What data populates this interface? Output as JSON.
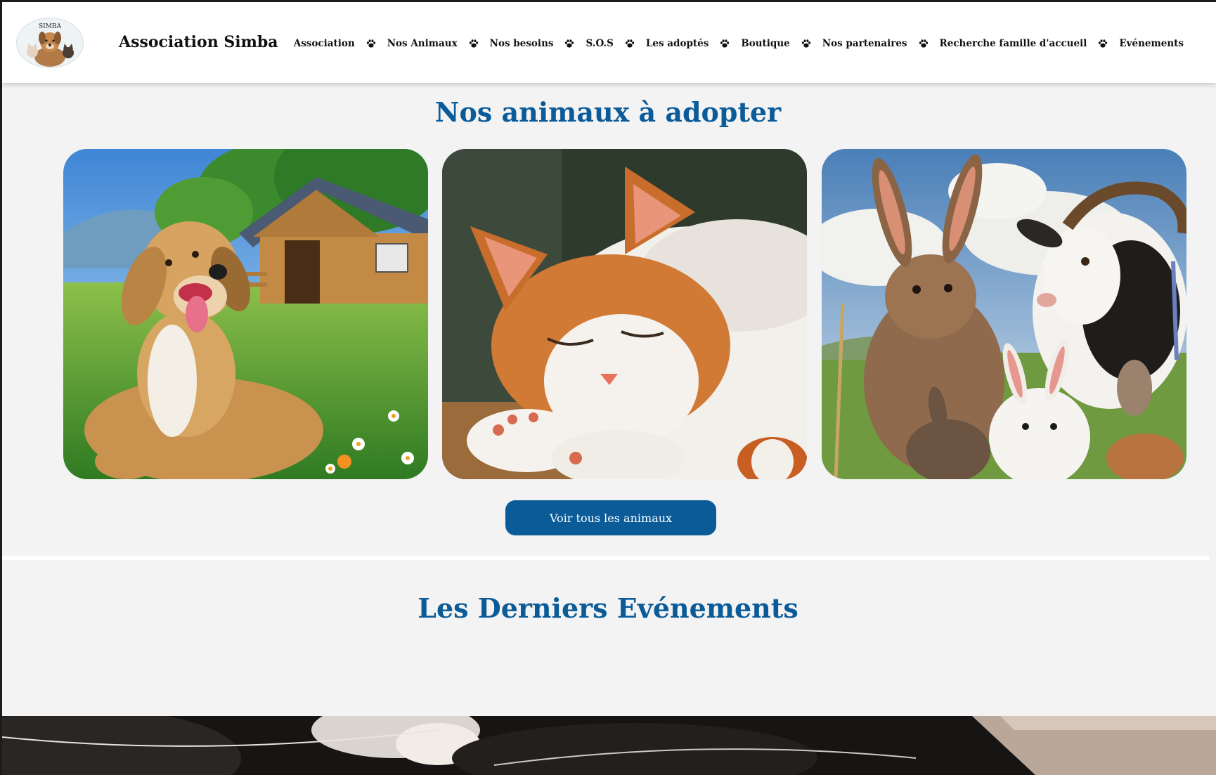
{
  "header": {
    "site_title": "Association Simba",
    "logo": {
      "text": "SIMBA",
      "icon": "dog-cat-logo"
    },
    "nav": [
      {
        "label": "Association"
      },
      {
        "label": "Nos Animaux"
      },
      {
        "label": "Nos besoins"
      },
      {
        "label": "S.O.S"
      },
      {
        "label": "Les adoptés"
      },
      {
        "label": "Boutique"
      },
      {
        "label": "Nos partenaires"
      },
      {
        "label": "Recherche famille d'accueil"
      },
      {
        "label": "Evénements"
      }
    ],
    "separator_icon": "paw-icon"
  },
  "adopt_section": {
    "title": "Nos animaux à adopter",
    "cards": [
      {
        "name": "dog-card",
        "image": "dog-in-meadow"
      },
      {
        "name": "cat-card",
        "image": "sleeping-cat"
      },
      {
        "name": "farm-card",
        "image": "rabbits-and-goat"
      }
    ],
    "button_label": "Voir tous les animaux"
  },
  "events_section": {
    "title": "Les Derniers Evénements"
  },
  "colors": {
    "accent": "#0a5b98",
    "background": "#f3f3f4",
    "header_bg": "#ffffff"
  }
}
